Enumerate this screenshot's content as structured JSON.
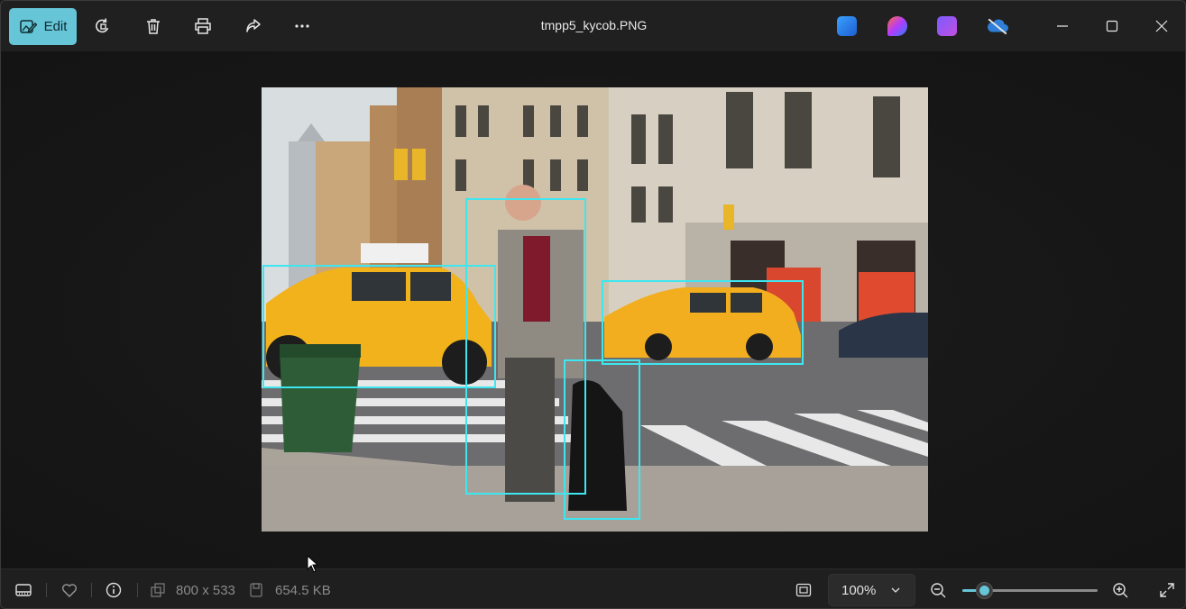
{
  "toolbar": {
    "edit_label": "Edit",
    "title": "tmpp5_kycob.PNG"
  },
  "icons": {
    "edit": "edit-image-icon",
    "rotate": "rotate-icon",
    "delete": "trash-icon",
    "print": "print-icon",
    "share": "share-icon",
    "more": "more-icon",
    "apps": [
      "photos-ai-icon",
      "copilot-icon",
      "clipchamp-icon",
      "onedrive-offline-icon"
    ]
  },
  "bottombar": {
    "dimensions": "800 x 533",
    "file_size": "654.5 KB",
    "zoom_value": "100%",
    "zoom_slider_fraction": 0.16
  },
  "detections": [
    {
      "label": "car"
    },
    {
      "label": "person"
    },
    {
      "label": "car"
    },
    {
      "label": "dog"
    }
  ],
  "colors": {
    "accent": "#66c5d6",
    "detection_box": "#3ee6ef"
  }
}
